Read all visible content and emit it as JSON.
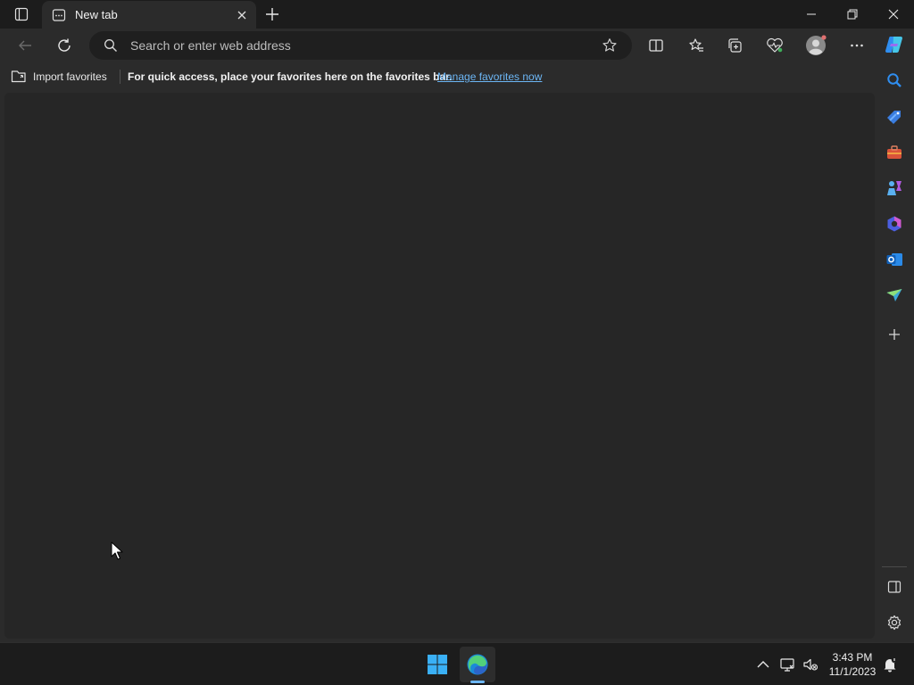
{
  "tab": {
    "title": "New tab"
  },
  "address_bar": {
    "placeholder": "Search or enter web address",
    "value": ""
  },
  "favorites_bar": {
    "import_label": "Import favorites",
    "message": "For quick access, place your favorites here on the favorites bar.",
    "link_label": "Manage favorites now"
  },
  "toolbar_icons": [
    "back-icon",
    "refresh-icon",
    "split-screen-icon",
    "favorites-icon",
    "collections-icon",
    "browser-essentials-icon",
    "profile-icon",
    "more-icon",
    "copilot-icon"
  ],
  "sidebar_icons": [
    "search-icon",
    "shopping-icon",
    "tools-icon",
    "games-icon",
    "microsoft-365-icon",
    "outlook-icon",
    "drop-icon",
    "add-icon",
    "hide-sidebar-icon",
    "settings-icon"
  ],
  "taskbar": {
    "time": "3:43 PM",
    "date": "11/1/2023",
    "apps": [
      "start-icon",
      "edge-icon"
    ]
  },
  "colors": {
    "accent": "#6cb6f5",
    "background": "#202020",
    "surface": "#2b2b2b",
    "page": "#262626"
  }
}
